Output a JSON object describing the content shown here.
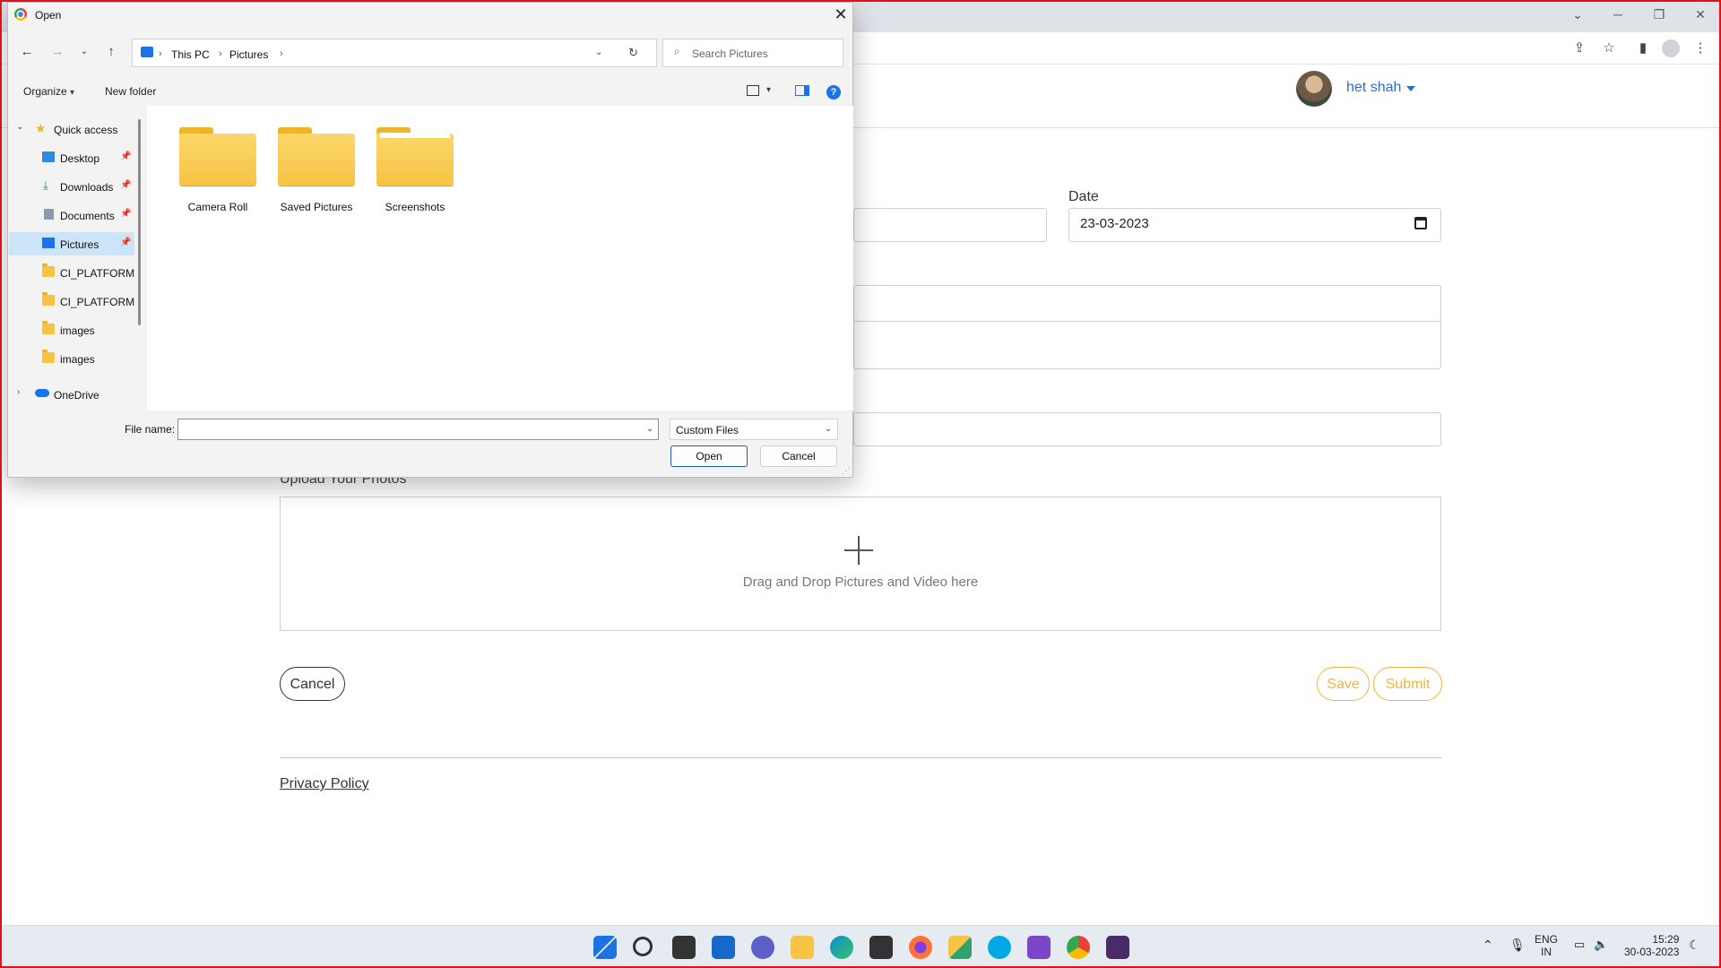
{
  "dialog": {
    "title": "Open",
    "breadcrumb": [
      "This PC",
      "Pictures"
    ],
    "search_placeholder": "Search Pictures",
    "toolbar": {
      "organize": "Organize",
      "new_folder": "New folder"
    },
    "nav_items": [
      {
        "label": "Quick access",
        "icon": "star-icon"
      },
      {
        "label": "Desktop",
        "icon": "desktop-icon",
        "pinned": true
      },
      {
        "label": "Downloads",
        "icon": "download-icon",
        "pinned": true
      },
      {
        "label": "Documents",
        "icon": "documents-icon",
        "pinned": true
      },
      {
        "label": "Pictures",
        "icon": "pictures-icon",
        "pinned": true,
        "selected": true
      },
      {
        "label": "CI_PLATFORM",
        "icon": "folder-icon"
      },
      {
        "label": "CI_PLATFORM-",
        "icon": "folder-icon"
      },
      {
        "label": "images",
        "icon": "folder-icon"
      },
      {
        "label": "images",
        "icon": "folder-icon"
      },
      {
        "label": "OneDrive",
        "icon": "cloud-icon"
      }
    ],
    "folders": [
      "Camera Roll",
      "Saved Pictures",
      "Screenshots"
    ],
    "file_name_label": "File name:",
    "file_name_value": "",
    "file_type": "Custom Files",
    "open_label": "Open",
    "cancel_label": "Cancel"
  },
  "page": {
    "user_name": "het shah",
    "date_label": "Date",
    "date_value": "23-03-2023",
    "upload_label": "Upload Your Photos",
    "drop_text": "Drag and Drop Pictures and Video here",
    "cancel_label": "Cancel",
    "save_label": "Save",
    "submit_label": "Submit",
    "privacy_label": "Privacy Policy"
  },
  "tray": {
    "lang_line1": "ENG",
    "lang_line2": "IN",
    "time": "15:29",
    "date": "30-03-2023"
  },
  "colors": {
    "accent_yellow": "#f3b43c",
    "link_blue": "#2a6fd6",
    "selection": "#cce4f7",
    "frame_red": "#e0101c"
  }
}
